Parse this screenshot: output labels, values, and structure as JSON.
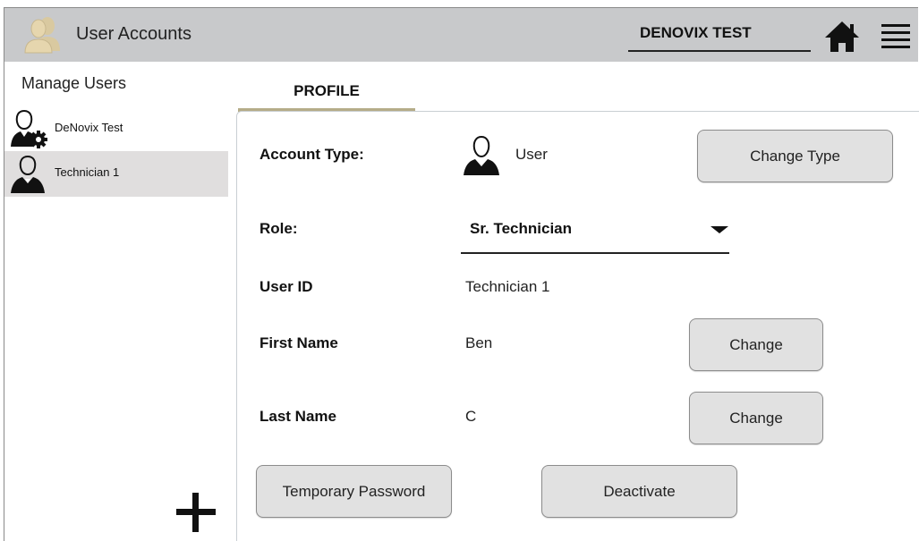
{
  "header": {
    "title": "User Accounts",
    "current_user": "DENOVIX TEST",
    "icons": [
      "users-icon",
      "home-icon",
      "menu-icon"
    ]
  },
  "sidebar": {
    "title": "Manage Users",
    "users": [
      {
        "name": "DeNovix Test",
        "icon": "admin-user-icon",
        "selected": false
      },
      {
        "name": "Technician 1",
        "icon": "user-icon",
        "selected": true
      }
    ],
    "add_icon": "plus-icon"
  },
  "tabs": [
    {
      "label": "PROFILE",
      "active": true
    }
  ],
  "profile": {
    "account_type_label": "Account Type:",
    "account_type_value": "User",
    "change_type_button": "Change Type",
    "role_label": "Role:",
    "role_value": "Sr. Technician",
    "user_id_label": "User ID",
    "user_id_value": "Technician 1",
    "first_name_label": "First Name",
    "first_name_value": "Ben",
    "first_name_change_button": "Change",
    "last_name_label": "Last Name",
    "last_name_value": "C",
    "last_name_change_button": "Change",
    "temp_password_button": "Temporary Password",
    "deactivate_button": "Deactivate"
  },
  "colors": {
    "header_bg": "#c8c9cb",
    "selected_row": "#e0dede",
    "tab_underline": "#b5ac88",
    "button_bg": "#e1e1e1"
  }
}
